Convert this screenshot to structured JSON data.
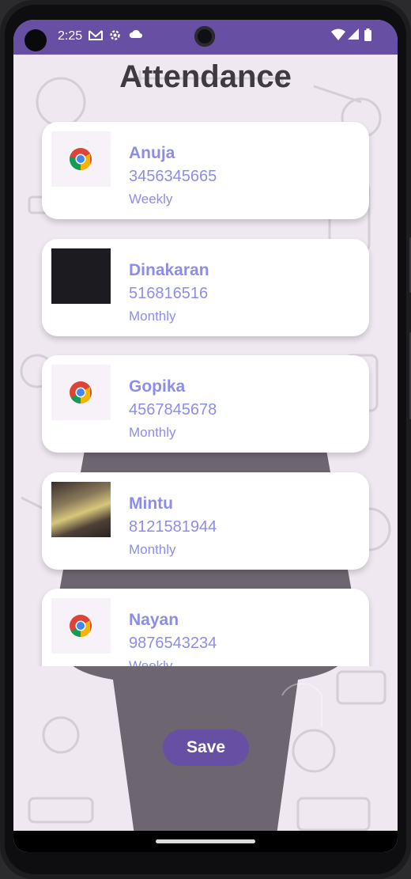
{
  "status_bar": {
    "time": "2:25",
    "left_icons": [
      "gmail-icon",
      "settings-icon",
      "cloud-icon"
    ],
    "right_icons": [
      "wifi-icon",
      "signal-icon",
      "battery-icon"
    ]
  },
  "page": {
    "title": "Attendance"
  },
  "members": [
    {
      "name": "Anuja",
      "phone": "3456345665",
      "plan": "Weekly",
      "thumb": "chrome-icon"
    },
    {
      "name": "Dinakaran",
      "phone": "516816516",
      "plan": "Monthly",
      "thumb": "dark-image"
    },
    {
      "name": "Gopika",
      "phone": "4567845678",
      "plan": "Monthly",
      "thumb": "chrome-icon"
    },
    {
      "name": "Mintu",
      "phone": "8121581944",
      "plan": "Monthly",
      "thumb": "photo"
    },
    {
      "name": "Nayan",
      "phone": "9876543234",
      "plan": "Weekly",
      "thumb": "chrome-icon"
    }
  ],
  "actions": {
    "save_label": "Save"
  },
  "colors": {
    "accent": "#6750a4",
    "text_accent": "#8c8ee6",
    "background": "#efe8f1"
  }
}
